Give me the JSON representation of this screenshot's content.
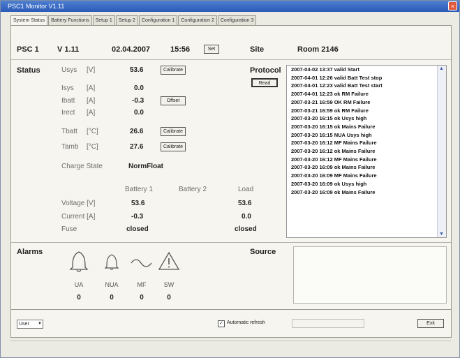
{
  "window": {
    "title": "PSC1 Monitor V1.11",
    "close_glyph": "×"
  },
  "tabs": [
    "System Status",
    "Battery Functions",
    "Setup 1",
    "Setup 2",
    "Configuration 1",
    "Configuration 2",
    "Configuration 3"
  ],
  "header": {
    "device": "PSC 1",
    "version": "V 1.11",
    "date": "02.04.2007",
    "time": "15:56",
    "set_button": "Set",
    "site_label": "Site",
    "site_value": "Room 2146"
  },
  "status": {
    "label": "Status",
    "usys": {
      "name": "Usys",
      "unit": "[V]",
      "value": "53.6",
      "button": "Calibrate"
    },
    "isys": {
      "name": "Isys",
      "unit": "[A]",
      "value": "0.0"
    },
    "ibatt": {
      "name": "Ibatt",
      "unit": "[A]",
      "value": "-0.3",
      "button": "Offset"
    },
    "irect": {
      "name": "Irect",
      "unit": "[A]",
      "value": "0.0"
    },
    "tbatt": {
      "name": "Tbatt",
      "unit": "[°C]",
      "value": "26.6",
      "button": "Calibrate"
    },
    "tamb": {
      "name": "Tamb",
      "unit": "[°C]",
      "value": "27.6",
      "button": "Calibrate"
    },
    "charge_state_label": "Charge State",
    "charge_state_value": "NormFloat"
  },
  "battery_table": {
    "headers": [
      "Battery 1",
      "Battery 2",
      "Load"
    ],
    "rows": [
      {
        "label": "Voltage [V]",
        "b1": "53.6",
        "b2": "",
        "load": "53.6"
      },
      {
        "label": "Current [A]",
        "b1": "-0.3",
        "b2": "",
        "load": "0.0"
      },
      {
        "label": "Fuse",
        "b1": "closed",
        "b2": "",
        "load": "closed"
      }
    ]
  },
  "protocol": {
    "label": "Protocol",
    "button": "Read",
    "entries": [
      "2007-04-02 13:37 valid Start",
      "2007-04-01 12:26 valid Batt Test stop",
      "2007-04-01 12:23 valid Batt Test start",
      "2007-04-01 12:23 ok RM Failure",
      "2007-03-21 16:59 OK RM Failure",
      "2007-03-21 16:59 ok RM Failure",
      "2007-03-20 16:15 ok Usys high",
      "2007-03-20 16:15 ok Mains Failure",
      "2007-03-20 16:15 NUA Usys high",
      "2007-03-20 16:12 MF Mains Failure",
      "2007-03-20 16:12 ok Mains Failure",
      "2007-03-20 16:12 MF Mains Failure",
      "2007-03-20 16:09 ok Mains Failure",
      "2007-03-20 16:09 MF Mains Failure",
      "2007-03-20 16:09 ok Usys high",
      "2007-03-20 16:09 ok Mains Failure"
    ]
  },
  "alarms": {
    "label": "Alarms",
    "items": [
      {
        "name": "UA",
        "count": "0",
        "icon": "bell-large-icon"
      },
      {
        "name": "NUA",
        "count": "0",
        "icon": "bell-small-icon"
      },
      {
        "name": "MF",
        "count": "0",
        "icon": "sine-wave-icon"
      },
      {
        "name": "SW",
        "count": "0",
        "icon": "warning-triangle-icon"
      }
    ],
    "source_label": "Source"
  },
  "footer": {
    "language_select": "User",
    "auto_refresh_label": "Automatic refresh",
    "auto_refresh_checked": true,
    "exit_button": "Exit"
  },
  "colors": {
    "titlebar": "#2a5ab8",
    "panel": "#f6f5ef",
    "window": "#ecebe3"
  }
}
